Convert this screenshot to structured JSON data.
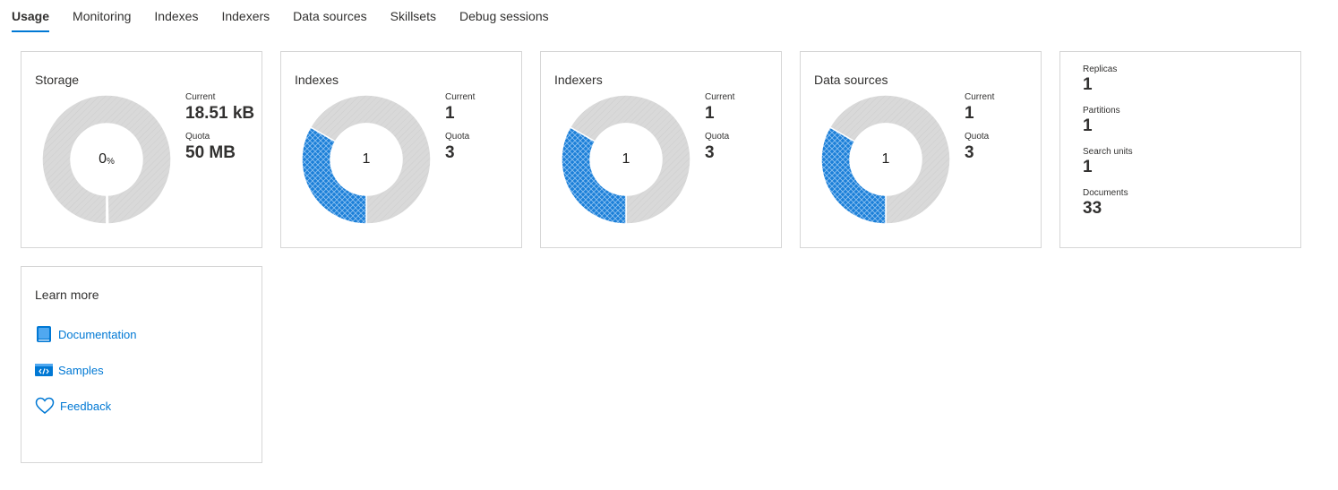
{
  "tabs": [
    {
      "label": "Usage",
      "active": true
    },
    {
      "label": "Monitoring",
      "active": false
    },
    {
      "label": "Indexes",
      "active": false
    },
    {
      "label": "Indexers",
      "active": false
    },
    {
      "label": "Data sources",
      "active": false
    },
    {
      "label": "Skillsets",
      "active": false
    },
    {
      "label": "Debug sessions",
      "active": false
    }
  ],
  "colors": {
    "accent": "#0078d4",
    "donut_used": "#1b7fd8",
    "donut_free": "#d9d9d9"
  },
  "cards": {
    "storage": {
      "title": "Storage",
      "center_value": "0",
      "center_unit": "%",
      "current_label": "Current",
      "current_value": "18.51 kB",
      "quota_label": "Quota",
      "quota_value": "50 MB",
      "used_fraction": 0.0004
    },
    "indexes": {
      "title": "Indexes",
      "center_value": "1",
      "current_label": "Current",
      "current_value": "1",
      "quota_label": "Quota",
      "quota_value": "3",
      "used_fraction": 0.3333
    },
    "indexers": {
      "title": "Indexers",
      "center_value": "1",
      "current_label": "Current",
      "current_value": "1",
      "quota_label": "Quota",
      "quota_value": "3",
      "used_fraction": 0.3333
    },
    "datasources": {
      "title": "Data sources",
      "center_value": "1",
      "current_label": "Current",
      "current_value": "1",
      "quota_label": "Quota",
      "quota_value": "3",
      "used_fraction": 0.3333
    }
  },
  "summary": {
    "replicas_label": "Replicas",
    "replicas_value": "1",
    "partitions_label": "Partitions",
    "partitions_value": "1",
    "search_units_label": "Search units",
    "search_units_value": "1",
    "documents_label": "Documents",
    "documents_value": "33"
  },
  "learn_more": {
    "title": "Learn more",
    "links": [
      {
        "label": "Documentation",
        "icon": "book-icon"
      },
      {
        "label": "Samples",
        "icon": "code-icon"
      },
      {
        "label": "Feedback",
        "icon": "heart-icon"
      }
    ]
  }
}
